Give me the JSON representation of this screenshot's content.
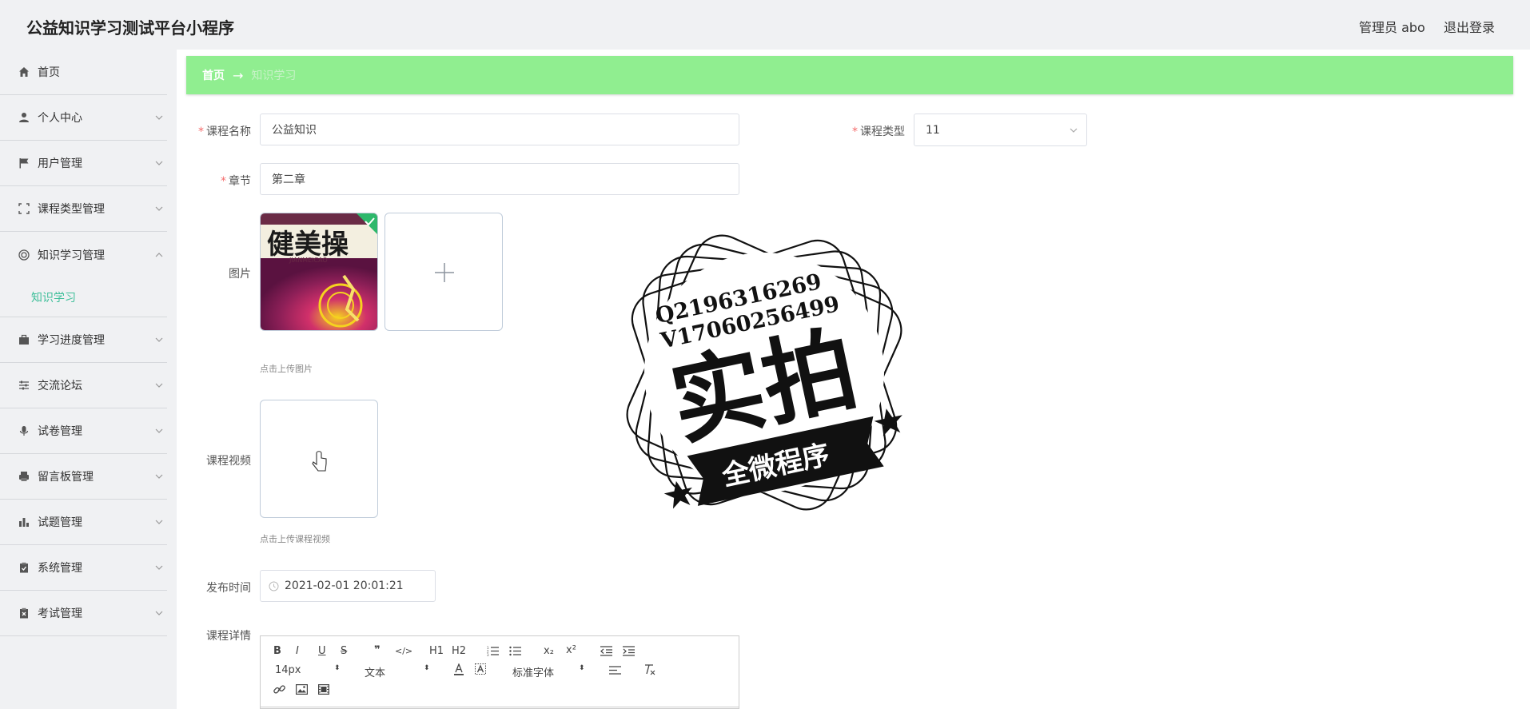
{
  "header": {
    "title": "公益知识学习测试平台小程序",
    "user_label": "管理员 abo",
    "logout_label": "退出登录"
  },
  "sidebar": {
    "items": [
      {
        "label": "首页",
        "icon": "home-icon",
        "expandable": false
      },
      {
        "label": "个人中心",
        "icon": "user-icon",
        "expandable": true
      },
      {
        "label": "用户管理",
        "icon": "flag-icon",
        "expandable": true
      },
      {
        "label": "课程类型管理",
        "icon": "fullscreen-icon",
        "expandable": true
      },
      {
        "label": "知识学习管理",
        "icon": "target-icon",
        "expandable": true,
        "expanded": true
      },
      {
        "label": "学习进度管理",
        "icon": "briefcase-icon",
        "expandable": true
      },
      {
        "label": "交流论坛",
        "icon": "sliders-icon",
        "expandable": true
      },
      {
        "label": "试卷管理",
        "icon": "microphone-icon",
        "expandable": true
      },
      {
        "label": "留言板管理",
        "icon": "printer-icon",
        "expandable": true
      },
      {
        "label": "试题管理",
        "icon": "bar-chart-icon",
        "expandable": true
      },
      {
        "label": "系统管理",
        "icon": "clipboard-check-icon",
        "expandable": true
      },
      {
        "label": "考试管理",
        "icon": "clipboard-x-icon",
        "expandable": true
      }
    ],
    "subitem": "知识学习"
  },
  "breadcrumb": {
    "home": "首页",
    "separator": "→",
    "current": "知识学习"
  },
  "form": {
    "course_name_label": "课程名称",
    "course_name_value": "公益知识",
    "course_type_label": "课程类型",
    "course_type_value": "11",
    "chapter_label": "章节",
    "chapter_value": "第二章",
    "image_label": "图片",
    "image_tip": "点击上传图片",
    "book_cover_text": "健美操",
    "book_cover_pinyin": "JIANMEICAO",
    "video_label": "课程视频",
    "video_tip": "点击上传课程视频",
    "publish_time_label": "发布时间",
    "publish_time_value": "2021-02-01 20:01:21",
    "detail_label": "课程详情"
  },
  "editor": {
    "toolbar_row1": [
      "B",
      "I",
      "U",
      "S",
      "❞",
      "</>",
      "H1",
      "H2",
      "ordered-list-icon",
      "bullet-list-icon",
      "x₂",
      "x²",
      "outdent-icon",
      "indent-icon"
    ],
    "font_size": "14px",
    "header_select": "文本",
    "font_family": "标准字体",
    "toolbar_row3": [
      "link-icon",
      "image-icon",
      "video-icon"
    ]
  },
  "watermark": {
    "line1": "Q2196316269",
    "line2": "V17060256499",
    "main": "实拍",
    "banner": "全微程序"
  },
  "colors": {
    "breadcrumb_bg": "#90ee90",
    "accent": "#3fbf9a",
    "required": "#f56c6c"
  }
}
